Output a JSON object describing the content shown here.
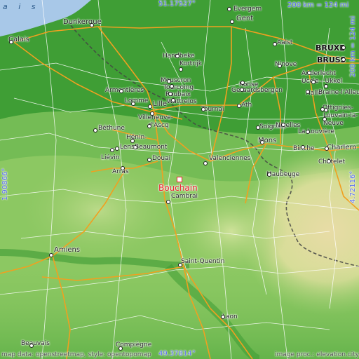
{
  "map": {
    "place_name": "Bouchain",
    "colors": {
      "sea": "#a8c8e8",
      "lowland": "#3f9e35",
      "midland": "#7cc05a",
      "upland": "#c5dc8c",
      "highland": "#e6e0a8",
      "road_major": "#f0a020",
      "road_minor": "#ffffff",
      "border": "#333333",
      "highlight": "#e8202a",
      "coordinate_text": "#5a6ff0"
    },
    "coordinates": {
      "top": "51.17527°",
      "bottom": "49.37814°",
      "left": "1.90866°",
      "right": "4.72116°"
    },
    "scale": {
      "horizontal": "200 km = 124 mi",
      "vertical": "200 km = 124 mi"
    },
    "attribution_left": "map data: openstreetmap, style: opentopomap",
    "attribution_right": "image proc.: elevation.city",
    "sea_label": "a i s",
    "cities": [
      {
        "name": "Evergem",
        "class": ""
      },
      {
        "name": "Gent",
        "class": "big"
      },
      {
        "name": "Dunkerque",
        "class": "big"
      },
      {
        "name": "Calais",
        "class": "big"
      },
      {
        "name": "Harelbeke",
        "class": ""
      },
      {
        "name": "Kortrijk",
        "class": ""
      },
      {
        "name": "Aalst",
        "class": ""
      },
      {
        "name": "BRUXE",
        "class": "capital"
      },
      {
        "name": "BRUSS",
        "class": "capital"
      },
      {
        "name": "Ninove",
        "class": ""
      },
      {
        "name": "Anderlecht",
        "class": ""
      },
      {
        "name": "Uccle - Ukkel",
        "class": ""
      },
      {
        "name": "Halle",
        "class": ""
      },
      {
        "name": "Braine-l'Alleud",
        "class": ""
      },
      {
        "name": "Ottignies-",
        "class": ""
      },
      {
        "name": "Louvain-la-",
        "class": ""
      },
      {
        "name": "Neuve",
        "class": ""
      },
      {
        "name": "Mouscron",
        "class": ""
      },
      {
        "name": "Tourcoing",
        "class": ""
      },
      {
        "name": "Roubaix",
        "class": ""
      },
      {
        "name": "Wattrelos",
        "class": ""
      },
      {
        "name": "Ronse",
        "class": ""
      },
      {
        "name": "Geraardsbergen",
        "class": ""
      },
      {
        "name": "Armentières",
        "class": ""
      },
      {
        "name": "Lomme",
        "class": ""
      },
      {
        "name": "Lille",
        "class": "big"
      },
      {
        "name": "Tournai",
        "class": ""
      },
      {
        "name": "Ath",
        "class": ""
      },
      {
        "name": "Villeneuve-",
        "class": ""
      },
      {
        "name": "d'Ascq",
        "class": ""
      },
      {
        "name": "Béthune",
        "class": ""
      },
      {
        "name": "Soignies",
        "class": ""
      },
      {
        "name": "Nivelles",
        "class": ""
      },
      {
        "name": "La Louvière",
        "class": ""
      },
      {
        "name": "Hénin-",
        "class": ""
      },
      {
        "name": "Beaumont",
        "class": ""
      },
      {
        "name": "Lens",
        "class": ""
      },
      {
        "name": "Liévin",
        "class": ""
      },
      {
        "name": "Mons",
        "class": "big"
      },
      {
        "name": "Binche",
        "class": ""
      },
      {
        "name": "Charlero",
        "class": "big"
      },
      {
        "name": "Châtelet",
        "class": ""
      },
      {
        "name": "Douai",
        "class": ""
      },
      {
        "name": "Valenciennes",
        "class": ""
      },
      {
        "name": "Arras",
        "class": ""
      },
      {
        "name": "Maubeuge",
        "class": ""
      },
      {
        "name": "Cambrai",
        "class": ""
      },
      {
        "name": "Amiens",
        "class": "big"
      },
      {
        "name": "Saint-Quentin",
        "class": ""
      },
      {
        "name": "Laon",
        "class": ""
      },
      {
        "name": "Beauvais",
        "class": ""
      },
      {
        "name": "Compiègne",
        "class": ""
      }
    ]
  }
}
